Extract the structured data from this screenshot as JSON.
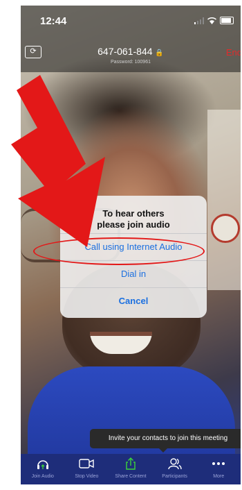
{
  "status_bar": {
    "time": "12:44"
  },
  "meeting": {
    "id": "647-061-844",
    "password": "Password: 100961",
    "end_label": "End"
  },
  "dialog": {
    "title_line1": "To hear others",
    "title_line2": "please join audio",
    "options": [
      "Call using Internet Audio",
      "Dial in",
      "Cancel"
    ]
  },
  "tooltip": "Invite your contacts to join this meeting",
  "toolbar": {
    "items": [
      {
        "label": "Join Audio",
        "icon": "headphones-icon"
      },
      {
        "label": "Stop Video",
        "icon": "video-camera-icon"
      },
      {
        "label": "Share Content",
        "icon": "share-icon"
      },
      {
        "label": "Participants",
        "icon": "participants-icon"
      },
      {
        "label": "More",
        "icon": "more-icon"
      }
    ]
  },
  "colors": {
    "annotation_red": "#e31818",
    "ios_blue": "#1a6fe0",
    "toolbar_bg": "#1e2d7a",
    "end_red": "#e32b2b"
  }
}
